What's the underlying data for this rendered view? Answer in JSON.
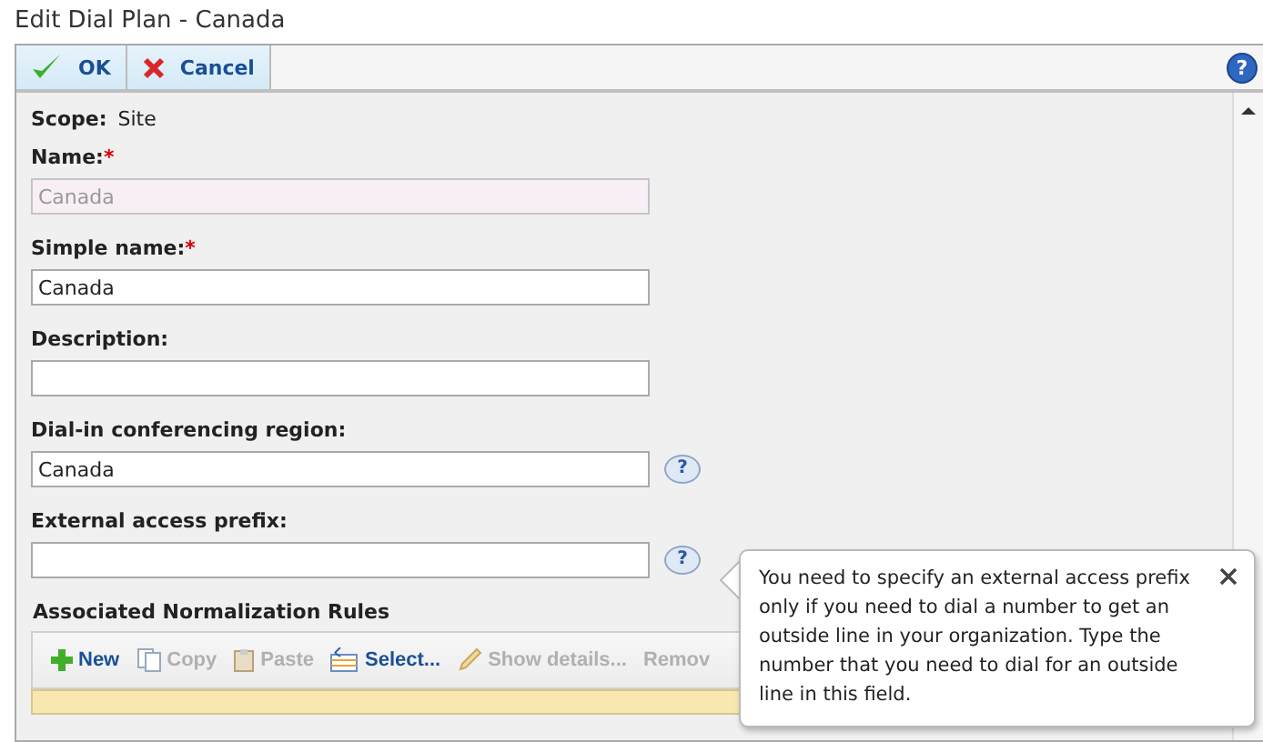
{
  "window": {
    "title": "Edit Dial Plan - Canada"
  },
  "toolbar": {
    "buttons": [
      {
        "kind": "ok",
        "label": "OK"
      },
      {
        "kind": "cancel",
        "label": "Cancel"
      }
    ],
    "help_icon": "?"
  },
  "scope": {
    "label": "Scope:",
    "value": "Site"
  },
  "fields": [
    {
      "label": "Name:",
      "required_mark": "*",
      "value": "Canada",
      "disabled": true
    },
    {
      "label": "Simple name:",
      "required_mark": "*",
      "value": "Canada",
      "disabled": false
    },
    {
      "label": "Description:",
      "disabled": false
    },
    {
      "label": "Dial-in conferencing region:",
      "value": "Canada",
      "disabled": false,
      "help_icon": "?"
    },
    {
      "label": "External access prefix:",
      "disabled": false,
      "help_icon": "?"
    }
  ],
  "rules_section": {
    "title": "Associated Normalization Rules",
    "actions": [
      {
        "kind": "new",
        "label": "New",
        "disabled": false
      },
      {
        "kind": "copy",
        "label": "Copy",
        "disabled": true
      },
      {
        "kind": "paste",
        "label": "Paste",
        "disabled": true
      },
      {
        "kind": "select",
        "label": "Select...",
        "disabled": false
      },
      {
        "kind": "details",
        "label": "Show details...",
        "disabled": true
      },
      {
        "kind": "remove",
        "label": "Remov",
        "disabled": true
      }
    ]
  },
  "tooltip": {
    "text": "You need to specify an external access prefix only if you need to dial a number to get an outside line in your organization. Type the number that you need to dial for an outside line in this field."
  }
}
